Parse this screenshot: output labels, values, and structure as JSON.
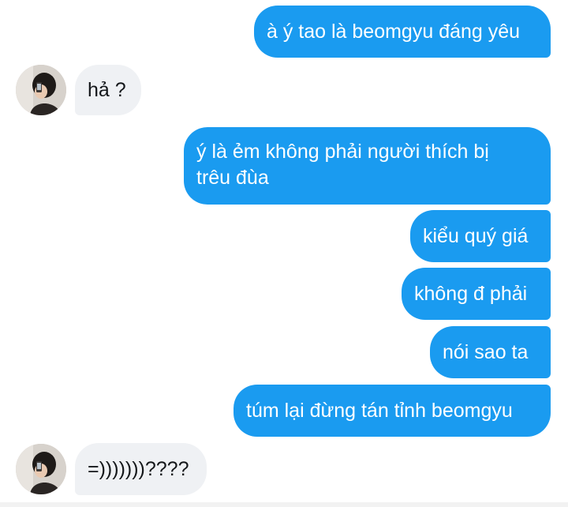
{
  "conversation": {
    "messages": [
      {
        "direction": "outgoing",
        "text": "à ý tao là beomgyu đáng yêu"
      },
      {
        "direction": "incoming",
        "text": "hả ?"
      },
      {
        "direction": "outgoing",
        "text": "ý là ẻm không phải người thích bị\ntrêu đùa"
      },
      {
        "direction": "outgoing",
        "text": "kiểu quý giá"
      },
      {
        "direction": "outgoing",
        "text": "không đ phải"
      },
      {
        "direction": "outgoing",
        "text": "nói sao ta"
      },
      {
        "direction": "outgoing",
        "text": "túm lại đừng tán tỉnh beomgyu"
      },
      {
        "direction": "incoming",
        "text": "=)))))))????"
      }
    ]
  },
  "colors": {
    "outgoing_bubble": "#1a9bf0",
    "incoming_bubble": "#eff1f4",
    "outgoing_text": "#ffffff",
    "incoming_text": "#14171a"
  },
  "icons": {
    "avatar": "user-avatar-photo"
  }
}
